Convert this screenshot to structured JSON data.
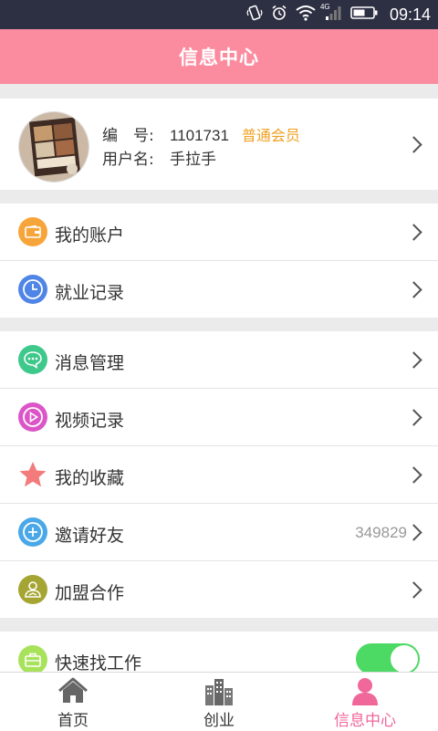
{
  "status_bar": {
    "network": "4G",
    "time": "09:14"
  },
  "header": {
    "title": "信息中心"
  },
  "profile": {
    "id_label": "编　号:",
    "id_value": "1101731",
    "member_badge": "普通会员",
    "username_label": "用户名:",
    "username_value": "手拉手"
  },
  "menu_group_1": [
    {
      "label": "我的账户",
      "icon": "wallet-icon",
      "color": "#f7a53a"
    },
    {
      "label": "就业记录",
      "icon": "clock-icon",
      "color": "#4f85e6"
    }
  ],
  "menu_group_2": [
    {
      "label": "消息管理",
      "icon": "chat-icon",
      "color": "#3fc88b"
    },
    {
      "label": "视频记录",
      "icon": "play-icon",
      "color": "#dc55c8"
    },
    {
      "label": "我的收藏",
      "icon": "star-icon",
      "color": "#f37b7b"
    },
    {
      "label": "邀请好友",
      "icon": "add-icon",
      "color": "#4aa8e8",
      "value": "349829"
    },
    {
      "label": "加盟合作",
      "icon": "handshake-icon",
      "color": "#a5a533"
    }
  ],
  "menu_group_3": [
    {
      "label": "快速找工作",
      "icon": "briefcase-icon",
      "color": "#a8e25b",
      "toggle_on": true
    }
  ],
  "tab_bar": [
    {
      "label": "首页",
      "icon": "home-icon",
      "active": false
    },
    {
      "label": "创业",
      "icon": "buildings-icon",
      "active": false
    },
    {
      "label": "信息中心",
      "icon": "user-icon",
      "active": true
    }
  ],
  "colors": {
    "header": "#fb8ca0",
    "status_bar": "#2d2f42",
    "badge": "#f0a020",
    "active_tab": "#f0679a",
    "toggle": "#4cd964"
  }
}
